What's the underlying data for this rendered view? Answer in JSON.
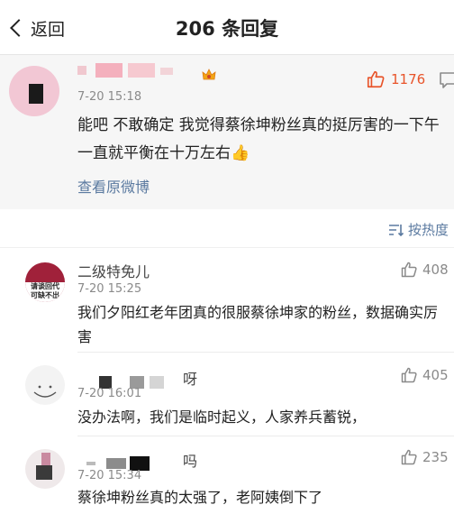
{
  "nav": {
    "back_label": "返回",
    "title": "206 条回复"
  },
  "main_post": {
    "time": "7-20 15:18",
    "likes": "1176",
    "text": "能吧  不敢确定 我觉得蔡徐坤粉丝真的挺厉害的一下午一直就平衡在十万左右👍",
    "view_original": "查看原微博"
  },
  "sort": {
    "label": "按热度"
  },
  "comments": [
    {
      "name": "二级特免儿",
      "avatar_text_1": "请谈回代",
      "avatar_text_2": "可缺不出",
      "time": "7-20 15:25",
      "likes": "408",
      "text": "我们夕阳红老年团真的很服蔡徐坤家的粉丝，数据确实厉害"
    },
    {
      "name": "呀",
      "time": "7-20 16:01",
      "likes": "405",
      "text": "没办法啊，我们是临时起义，人家养兵蓄锐，"
    },
    {
      "name": "吗",
      "time": "7-20 15:34",
      "likes": "235",
      "text": "蔡徐坤粉丝真的太强了，老阿姨倒下了"
    }
  ],
  "colors": {
    "accent_orange": "#e8542a",
    "link_blue": "#5b7aa0",
    "gray_text": "#8a8a8a"
  }
}
